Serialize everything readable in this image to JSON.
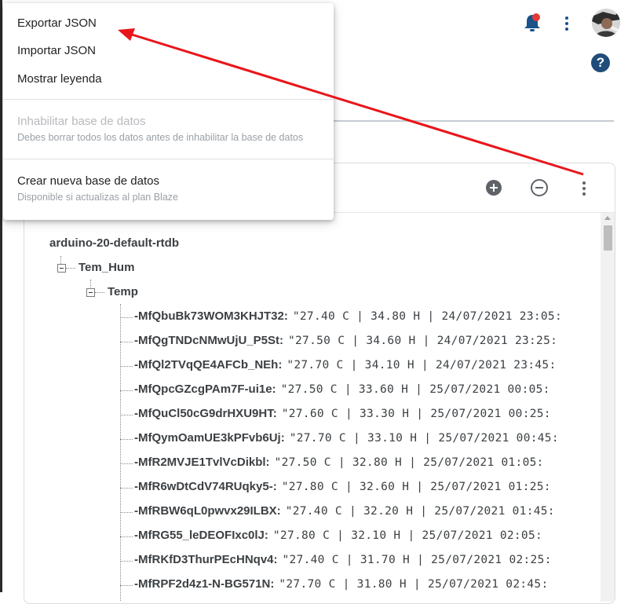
{
  "header": {
    "icons": {
      "notifications": "bell-icon",
      "more": "more-vert-icon",
      "help": "help-icon",
      "avatar": "avatar"
    },
    "help_glyph": "?"
  },
  "menu": {
    "items": [
      {
        "label": "Exportar JSON"
      },
      {
        "label": "Importar JSON"
      },
      {
        "label": "Mostrar leyenda"
      }
    ],
    "disabled_item": {
      "label": "Inhabilitar base de datos",
      "sub": "Debes borrar todos los datos antes de inhabilitar la base de datos"
    },
    "create_item": {
      "label": "Crear nueva base de datos",
      "sub": "Disponible si actualizas al plan Blaze"
    }
  },
  "database": {
    "root": "arduino-20-default-rtdb",
    "node1": "Tem_Hum",
    "node2": "Temp",
    "entries": [
      {
        "key": "-MfQbuBk73WOM3KHJT32:",
        "value": "\"27.40 C | 34.80 H | 24/07/2021 23:05:"
      },
      {
        "key": "-MfQgTNDcNMwUjU_P5St:",
        "value": "\"27.50 C | 34.60 H | 24/07/2021 23:25:"
      },
      {
        "key": "-MfQl2TVqQE4AFCb_NEh:",
        "value": "\"27.70 C | 34.10 H | 24/07/2021 23:45:"
      },
      {
        "key": "-MfQpcGZcgPAm7F-ui1e:",
        "value": "\"27.50 C | 33.60 H | 25/07/2021 00:05:"
      },
      {
        "key": "-MfQuCl50cG9drHXU9HT:",
        "value": "\"27.60 C | 33.30 H | 25/07/2021 00:25:"
      },
      {
        "key": "-MfQymOamUE3kPFvb6Uj:",
        "value": "\"27.70 C | 33.10 H | 25/07/2021 00:45:"
      },
      {
        "key": "-MfR2MVJE1TvlVcDikbl:",
        "value": "\"27.50 C | 32.80 H | 25/07/2021 01:05:"
      },
      {
        "key": "-MfR6wDtCdV74RUqky5-:",
        "value": "\"27.80 C | 32.60 H | 25/07/2021 01:25:"
      },
      {
        "key": "-MfRBW6qL0pwvx29ILBX:",
        "value": "\"27.40 C | 32.20 H | 25/07/2021 01:45:"
      },
      {
        "key": "-MfRG55_leDEOFIxc0lJ:",
        "value": "\"27.80 C | 32.10 H | 25/07/2021 02:05:"
      },
      {
        "key": "-MfRKfD3ThurPEcHNqv4:",
        "value": "\"27.40 C | 31.70 H | 25/07/2021 02:25:"
      },
      {
        "key": "-MfRPF2d4z1-N-BG571N:",
        "value": "\"27.70 C | 31.80 H | 25/07/2021 02:45:"
      }
    ]
  },
  "colors": {
    "annotation_arrow": "#e8161b",
    "accent": "#1a5289",
    "notification_dot": "#e53935"
  }
}
